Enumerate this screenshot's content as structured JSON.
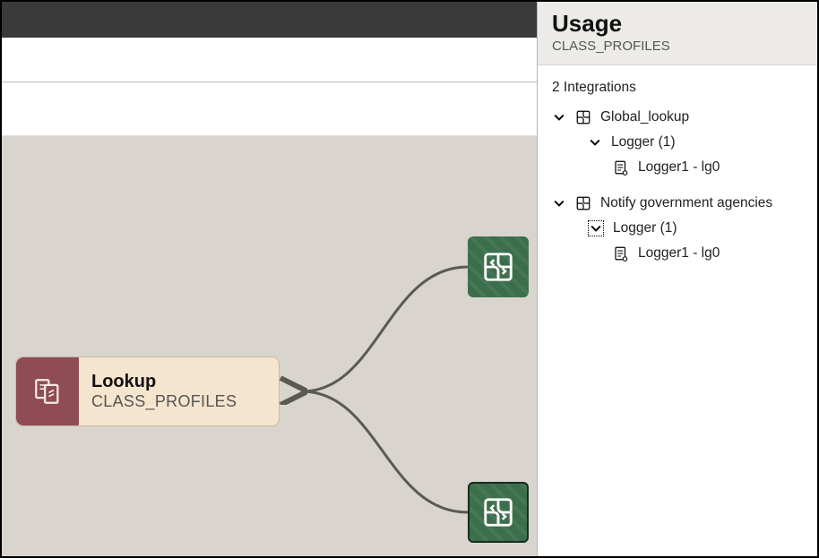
{
  "canvas": {
    "lookup": {
      "title": "Lookup",
      "subtitle": "CLASS_PROFILES"
    }
  },
  "panel": {
    "title": "Usage",
    "subtitle": "CLASS_PROFILES",
    "count_text": "2 Integrations",
    "integrations": [
      {
        "name": "Global_lookup",
        "group_label": "Logger (1)",
        "item_label": "Logger1 - lg0"
      },
      {
        "name": "Notify government agencies",
        "group_label": "Logger (1)",
        "item_label": "Logger1 - lg0"
      }
    ]
  }
}
